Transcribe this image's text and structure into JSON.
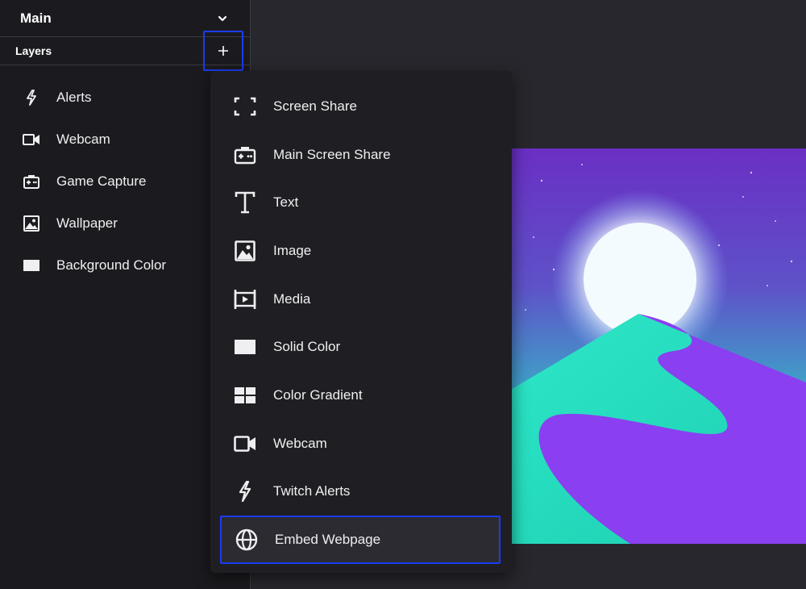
{
  "scene": {
    "title": "Main"
  },
  "layers": {
    "title": "Layers",
    "add_label": "+",
    "items": [
      {
        "label": "Alerts",
        "icon": "lightning-icon"
      },
      {
        "label": "Webcam",
        "icon": "webcam-icon"
      },
      {
        "label": "Game Capture",
        "icon": "game-capture-icon"
      },
      {
        "label": "Wallpaper",
        "icon": "image-icon"
      },
      {
        "label": "Background Color",
        "icon": "solid-color-icon"
      }
    ]
  },
  "add_menu": {
    "items": [
      {
        "label": "Screen Share",
        "icon": "screen-share-icon"
      },
      {
        "label": "Main Screen Share",
        "icon": "main-screen-share-icon"
      },
      {
        "label": "Text",
        "icon": "text-icon"
      },
      {
        "label": "Image",
        "icon": "image-icon"
      },
      {
        "label": "Media",
        "icon": "media-icon"
      },
      {
        "label": "Solid Color",
        "icon": "solid-color-icon"
      },
      {
        "label": "Color Gradient",
        "icon": "color-gradient-icon"
      },
      {
        "label": "Webcam",
        "icon": "webcam-icon"
      },
      {
        "label": "Twitch Alerts",
        "icon": "lightning-icon"
      },
      {
        "label": "Embed Webpage",
        "icon": "globe-icon"
      }
    ]
  },
  "colors": {
    "accent_outline": "#1a3cf0",
    "sidebar_bg": "#1b1b1f",
    "menu_bg": "#1f1f23",
    "canvas_bg": "#28272d"
  }
}
